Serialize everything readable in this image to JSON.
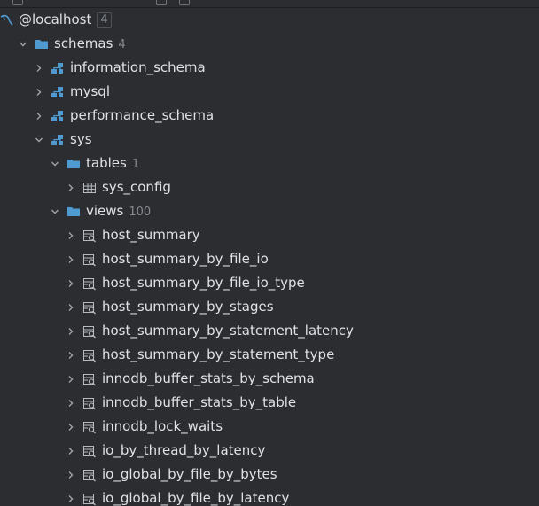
{
  "tree": {
    "root": {
      "label": "@localhost",
      "count": "4",
      "icon": "datasource-icon"
    },
    "schemas": {
      "label": "schemas",
      "count": "4",
      "icon": "folder-icon"
    },
    "schema_list": [
      {
        "label": "information_schema",
        "icon": "schema-icon",
        "expanded": false
      },
      {
        "label": "mysql",
        "icon": "schema-icon",
        "expanded": false
      },
      {
        "label": "performance_schema",
        "icon": "schema-icon",
        "expanded": false
      },
      {
        "label": "sys",
        "icon": "schema-icon",
        "expanded": true
      }
    ],
    "tables": {
      "label": "tables",
      "count": "1",
      "icon": "folder-icon"
    },
    "table_items": [
      {
        "label": "sys_config",
        "icon": "table-icon"
      }
    ],
    "views": {
      "label": "views",
      "count": "100",
      "icon": "folder-icon"
    },
    "view_items": [
      {
        "label": "host_summary",
        "icon": "view-icon"
      },
      {
        "label": "host_summary_by_file_io",
        "icon": "view-icon"
      },
      {
        "label": "host_summary_by_file_io_type",
        "icon": "view-icon"
      },
      {
        "label": "host_summary_by_stages",
        "icon": "view-icon"
      },
      {
        "label": "host_summary_by_statement_latency",
        "icon": "view-icon"
      },
      {
        "label": "host_summary_by_statement_type",
        "icon": "view-icon"
      },
      {
        "label": "innodb_buffer_stats_by_schema",
        "icon": "view-icon"
      },
      {
        "label": "innodb_buffer_stats_by_table",
        "icon": "view-icon"
      },
      {
        "label": "innodb_lock_waits",
        "icon": "view-icon"
      },
      {
        "label": "io_by_thread_by_latency",
        "icon": "view-icon"
      },
      {
        "label": "io_global_by_file_by_bytes",
        "icon": "view-icon"
      },
      {
        "label": "io_global_by_file_by_latency",
        "icon": "view-icon"
      }
    ]
  },
  "colors": {
    "background": "#2b2d30",
    "text": "#dfe1e5",
    "muted": "#868a91",
    "folder": "#4f9bd1",
    "schema": "#4f9bd1",
    "chevron": "#a0a3a8",
    "table_icon": "#b6b9be"
  }
}
